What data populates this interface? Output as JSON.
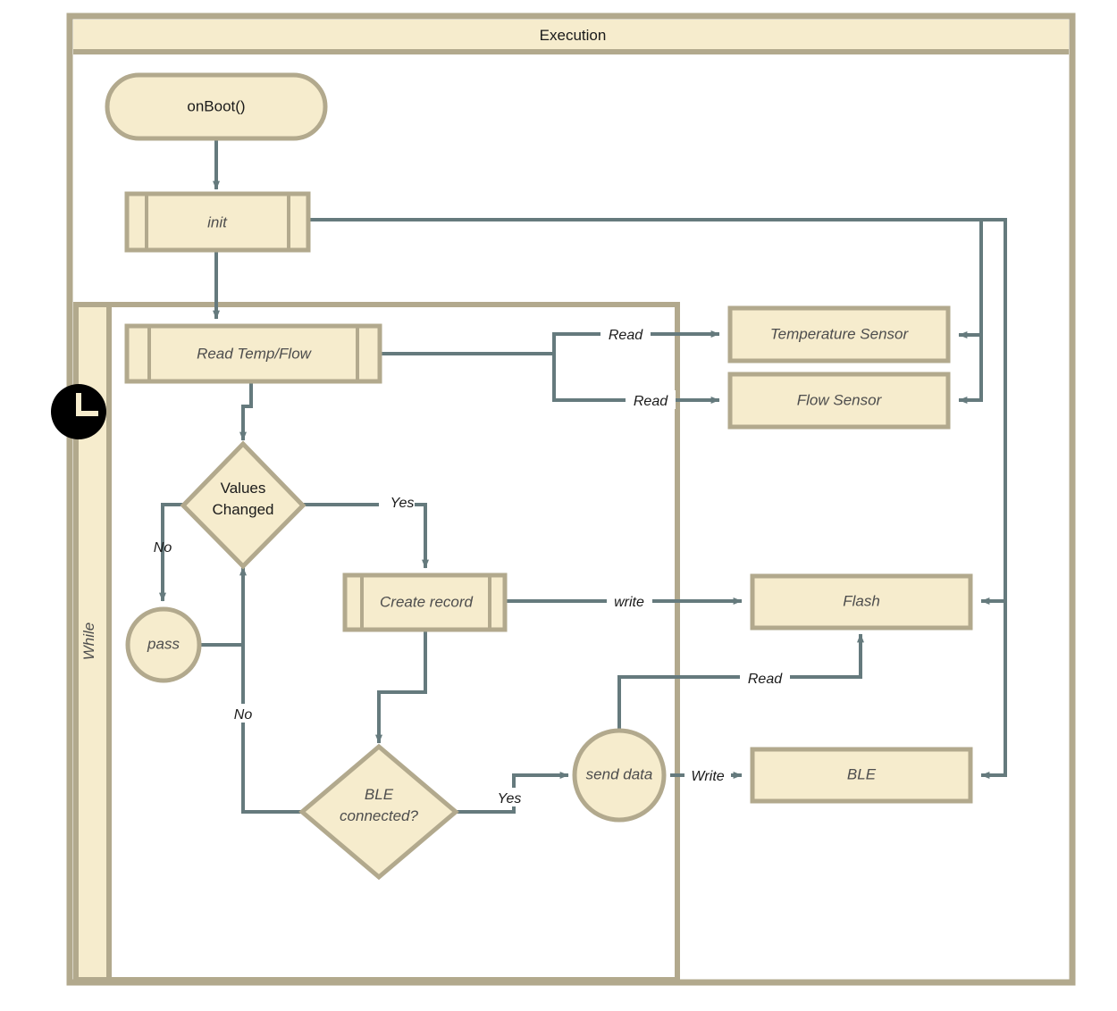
{
  "diagram": {
    "title": "Execution",
    "type": "activity-flowchart",
    "colors": {
      "fill": "#f6eccd",
      "stroke": "#b2a98d",
      "edge": "#657a7d",
      "text_dark": "#4d4d4d",
      "text_black": "#1a1a1a",
      "background": "#ffffff",
      "clock": "#000000"
    },
    "containers": {
      "outer": {
        "label": "Execution"
      },
      "loop": {
        "label": "While",
        "icon": "clock-icon"
      }
    },
    "nodes": {
      "on_boot": {
        "label": "onBoot()",
        "shape": "stadium"
      },
      "init": {
        "label": "init",
        "shape": "subroutine"
      },
      "read_temp_flow": {
        "label": "Read Temp/Flow",
        "shape": "subroutine"
      },
      "values_changed": {
        "label_line1": "Values",
        "label_line2": "Changed",
        "shape": "diamond"
      },
      "pass": {
        "label": "pass",
        "shape": "circle"
      },
      "create_record": {
        "label": "Create record",
        "shape": "subroutine"
      },
      "ble_connected": {
        "label_line1": "BLE",
        "label_line2": "connected?",
        "shape": "diamond"
      },
      "send_data": {
        "label": "send data",
        "shape": "circle"
      },
      "temperature_sensor": {
        "label": "Temperature Sensor",
        "shape": "rect"
      },
      "flow_sensor": {
        "label": "Flow Sensor",
        "shape": "rect"
      },
      "flash": {
        "label": "Flash",
        "shape": "rect"
      },
      "ble": {
        "label": "BLE",
        "shape": "rect"
      }
    },
    "edge_labels": {
      "read_temp": "Read",
      "read_flow": "Read",
      "values_changed_yes": "Yes",
      "values_changed_no": "No",
      "ble_connected_no": "No",
      "ble_connected_yes": "Yes",
      "create_record_write": "write",
      "send_data_read": "Read",
      "send_data_write": "Write"
    }
  }
}
